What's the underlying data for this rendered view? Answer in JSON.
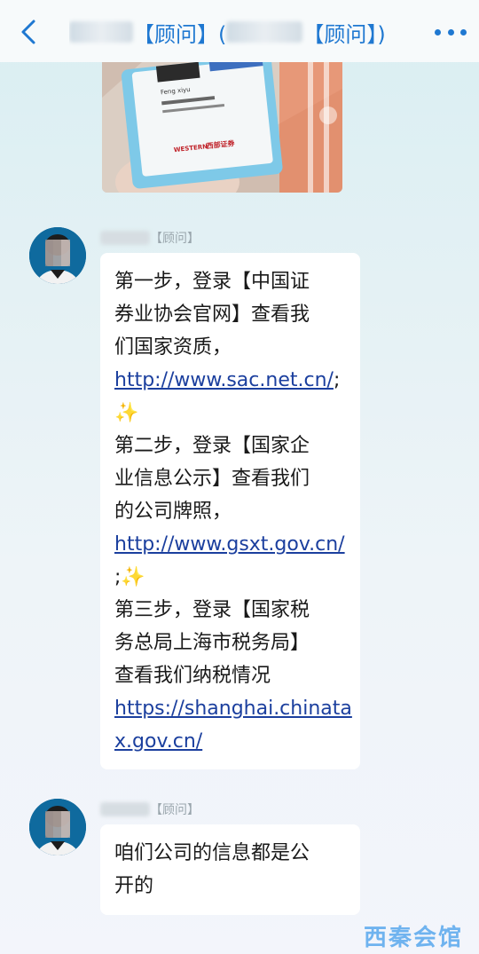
{
  "header": {
    "title_part1": "【顾问】(",
    "title_part2": "【顾问】)",
    "back_icon": "chevron-left-icon",
    "more_icon": "more-dots-icon"
  },
  "card": {
    "name_text": "Feng xiyu",
    "company_logo_text": "西部证券",
    "brand_text": "WESTERN"
  },
  "messages": [
    {
      "sender_role": "【顾问】",
      "lines": [
        "第一步，登录【中国证",
        "券业协会官网】查看我",
        "们国家资质，"
      ],
      "link1": "http://www.sac.net.cn/",
      "after_link1": ";",
      "sparkle1": "✨",
      "lines2": [
        "第二步，登录【国家企",
        "业信息公示】查看我们",
        "的公司牌照，"
      ],
      "link2": "http://www.gsxt.gov.cn/",
      "after_link2": ";",
      "sparkle2": "✨",
      "lines3": [
        "第三步，登录【国家税",
        "务总局上海市税务局】",
        "查看我们纳税情况"
      ],
      "link3_a": "https://shanghai.chinata",
      "link3_b": "x.gov.cn/"
    },
    {
      "sender_role": "【顾问】",
      "lines": [
        "咱们公司的信息都是公",
        "开的"
      ]
    }
  ],
  "watermark": "西秦会馆",
  "colors": {
    "accent": "#1f78d1",
    "link": "#1b3f9e",
    "bubble": "#ffffff",
    "watermark": "#6fb3ef"
  }
}
